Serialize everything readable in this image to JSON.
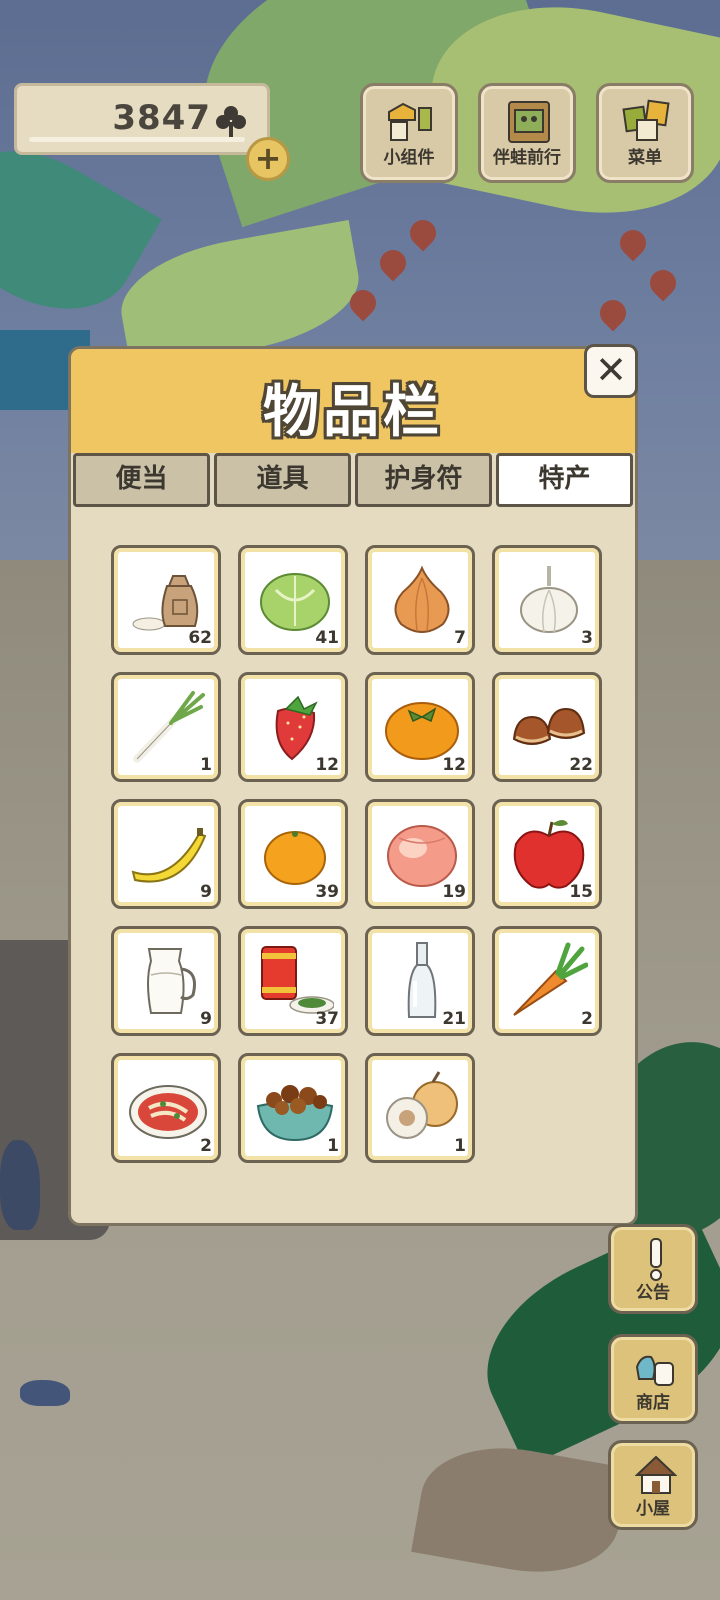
{
  "hud": {
    "clover_count": "3847",
    "add_label": "+",
    "buttons": [
      {
        "label": "小组件",
        "icon": "widget-icon"
      },
      {
        "label": "伴蛙前行",
        "icon": "frog-companion-icon"
      },
      {
        "label": "菜单",
        "icon": "menu-icon"
      }
    ]
  },
  "panel": {
    "title": "物品栏",
    "close_label": "✕",
    "tabs": [
      {
        "label": "便当",
        "active": false
      },
      {
        "label": "道具",
        "active": false
      },
      {
        "label": "护身符",
        "active": false
      },
      {
        "label": "特产",
        "active": true
      }
    ],
    "items": [
      {
        "icon": "rice-bag-icon",
        "qty": "62"
      },
      {
        "icon": "cabbage-icon",
        "qty": "41"
      },
      {
        "icon": "onion-icon",
        "qty": "7"
      },
      {
        "icon": "garlic-icon",
        "qty": "3"
      },
      {
        "icon": "green-onion-icon",
        "qty": "1"
      },
      {
        "icon": "strawberry-icon",
        "qty": "12"
      },
      {
        "icon": "persimmon-icon",
        "qty": "12"
      },
      {
        "icon": "chestnut-icon",
        "qty": "22"
      },
      {
        "icon": "banana-icon",
        "qty": "9"
      },
      {
        "icon": "orange-icon",
        "qty": "39"
      },
      {
        "icon": "peach-icon",
        "qty": "19"
      },
      {
        "icon": "apple-icon",
        "qty": "15"
      },
      {
        "icon": "milk-jug-icon",
        "qty": "9"
      },
      {
        "icon": "tea-can-icon",
        "qty": "37"
      },
      {
        "icon": "glass-bottle-icon",
        "qty": "21"
      },
      {
        "icon": "carrot-icon",
        "qty": "2"
      },
      {
        "icon": "noodle-plate-icon",
        "qty": "2"
      },
      {
        "icon": "braised-dish-icon",
        "qty": "1"
      },
      {
        "icon": "longan-icon",
        "qty": "1"
      }
    ]
  },
  "side": {
    "buttons": [
      {
        "label": "公告",
        "icon": "notice-icon"
      },
      {
        "label": "商店",
        "icon": "shop-icon"
      },
      {
        "label": "小屋",
        "icon": "house-icon"
      }
    ]
  },
  "colors": {
    "panel_header": "#efc662",
    "panel_bg": "#e4dbc0",
    "slot_inner": "#f3e2a8"
  }
}
